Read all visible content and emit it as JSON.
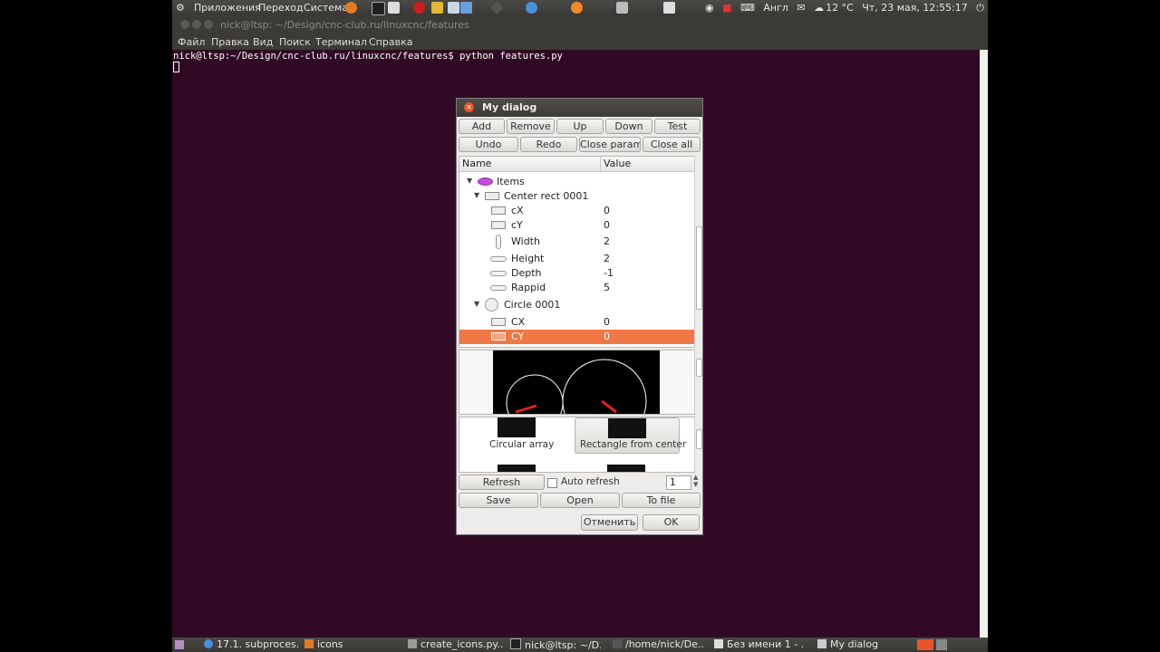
{
  "top_panel": {
    "menus": [
      "Приложения",
      "Переход",
      "Система"
    ],
    "tray": {
      "keyboard_layout": "Англ",
      "weather": "12 °C",
      "datetime": "Чт, 23 мая, 12:55:17"
    }
  },
  "terminal": {
    "title": "nick@ltsp: ~/Design/cnc-club.ru/linuxcnc/features",
    "menu": [
      "Файл",
      "Правка",
      "Вид",
      "Поиск",
      "Терминал",
      "Справка"
    ],
    "prompt_line": "nick@ltsp:~/Design/cnc-club.ru/linuxcnc/features$ python features.py"
  },
  "dialog": {
    "title": "My dialog",
    "toolbar_row1": [
      "Add",
      "Remove",
      "Up",
      "Down",
      "Test"
    ],
    "toolbar_row2": [
      "Undo",
      "Redo",
      "Close param",
      "Close all"
    ],
    "tree": {
      "columns": [
        "Name",
        "Value"
      ],
      "rows": [
        {
          "name": "Items",
          "value": "",
          "icon": "items-icon"
        },
        {
          "name": "Center rect 0001",
          "value": "",
          "icon": "rect-icon"
        },
        {
          "name": "cX",
          "value": "0",
          "icon": "rect-icon"
        },
        {
          "name": "cY",
          "value": "0",
          "icon": "rect-icon"
        },
        {
          "name": "Width",
          "value": "2",
          "icon": "vertical-arrow-icon"
        },
        {
          "name": "Height",
          "value": "2",
          "icon": "horizontal-arrow-icon"
        },
        {
          "name": "Depth",
          "value": "-1",
          "icon": "horizontal-arrow-icon"
        },
        {
          "name": "Rappid",
          "value": "5",
          "icon": "horizontal-arrow-icon"
        },
        {
          "name": "Circle 0001",
          "value": "",
          "icon": "circle-icon"
        },
        {
          "name": "CX",
          "value": "0",
          "icon": "rect-icon"
        },
        {
          "name": "CY",
          "value": "0",
          "icon": "rect-icon",
          "selected": true
        }
      ]
    },
    "gallery": [
      "Circular array",
      "Rectangle from center"
    ],
    "refresh_label": "Refresh",
    "auto_refresh_label": "Auto refresh",
    "auto_refresh_checked": false,
    "spin_value": "1",
    "save_label": "Save",
    "open_label": "Open",
    "to_file_label": "To file",
    "cancel_label": "Отменить",
    "ok_label": "OK",
    "selection_color": "#f07746"
  },
  "taskbar": {
    "tasks": [
      "17.1. subproces...",
      "icons",
      "create_icons.py...",
      "nick@ltsp: ~/D...",
      "/home/nick/De...",
      "Без имени 1 - ...",
      "My dialog"
    ]
  }
}
